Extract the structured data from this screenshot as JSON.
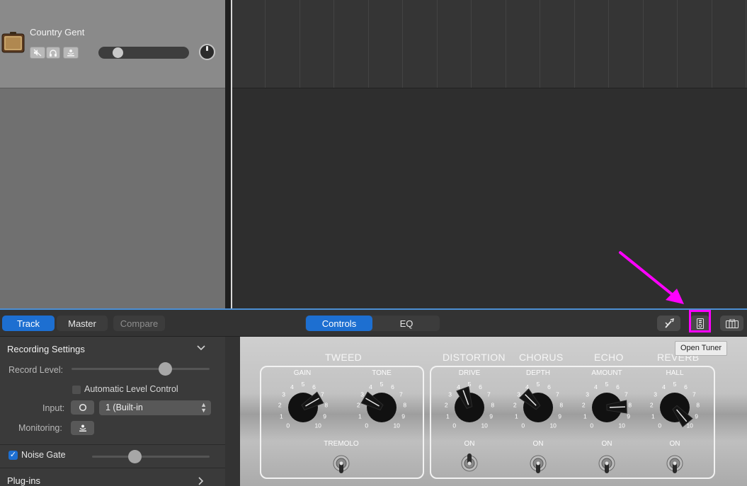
{
  "track": {
    "name": "Country Gent",
    "volume_fraction": 0.2
  },
  "toolbar": {
    "track_tab": "Track",
    "master_tab": "Master",
    "compare_button": "Compare",
    "controls_tab": "Controls",
    "eq_tab": "EQ"
  },
  "tooltip": "Open Tuner",
  "highlight_color": "#ff00ff",
  "accent_color": "#1d6fd1",
  "inspector": {
    "title": "Recording Settings",
    "record_level_label": "Record Level:",
    "automatic_level_control": "Automatic Level Control",
    "input_label": "Input:",
    "input_value": "1 (Built-in",
    "monitoring_label": "Monitoring:",
    "noise_gate_label": "Noise Gate",
    "plugins_label": "Plug-ins"
  },
  "amp": {
    "tweed": {
      "title": "TWEED",
      "gain_label": "GAIN",
      "tone_label": "TONE",
      "tremolo_label": "TREMOLO"
    },
    "distortion": {
      "title": "DISTORTION",
      "knob_label": "DRIVE",
      "switch_label": "ON"
    },
    "chorus": {
      "title": "CHORUS",
      "knob_label": "DEPTH",
      "switch_label": "ON"
    },
    "echo": {
      "title": "ECHO",
      "knob_label": "AMOUNT",
      "switch_label": "ON"
    },
    "reverb": {
      "title": "REVERB",
      "knob_label": "HALL",
      "switch_label": "ON"
    },
    "scale": [
      "0",
      "1",
      "2",
      "3",
      "4",
      "5",
      "6",
      "7",
      "8",
      "9",
      "10"
    ]
  }
}
